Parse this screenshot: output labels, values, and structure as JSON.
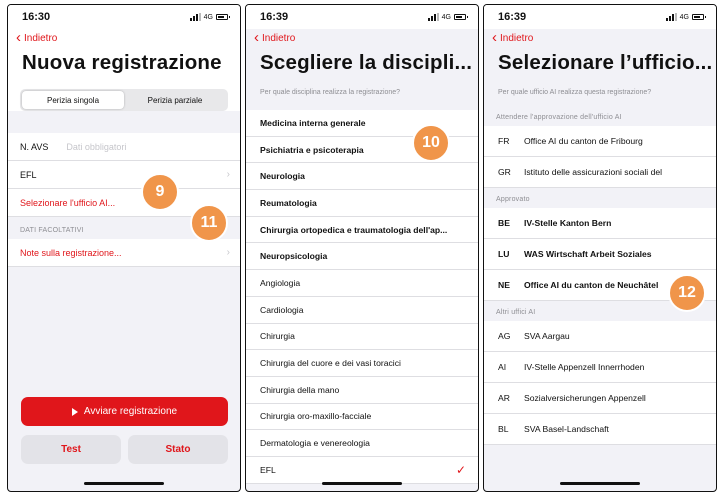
{
  "screen1": {
    "time": "16:30",
    "network": "4G",
    "back": "Indietro",
    "title": "Nuova registrazione",
    "segments": [
      "Perizia singola",
      "Perizia parziale"
    ],
    "avs_label": "N. AVS",
    "avs_placeholder": "Dati obbligatori",
    "efl": "EFL",
    "office": "Selezionare l'ufficio AI...",
    "optional_header": "DATI FACOLTATIVI",
    "notes": "Note sulla registrazione...",
    "start": "Avviare registrazione",
    "test": "Test",
    "status": "Stato"
  },
  "screen2": {
    "time": "16:39",
    "network": "4G",
    "back": "Indietro",
    "title": "Scegliere la discipli...",
    "question": "Per quale disciplina realizza la registrazione?",
    "items": [
      {
        "label": "Medicina interna generale",
        "bold": true
      },
      {
        "label": "Psichiatria e psicoterapia",
        "bold": true
      },
      {
        "label": "Neurologia",
        "bold": true
      },
      {
        "label": "Reumatologia",
        "bold": true
      },
      {
        "label": "Chirurgia ortopedica e traumatologia dell'ap...",
        "bold": true
      },
      {
        "label": "Neuropsicologia",
        "bold": true
      },
      {
        "label": "Angiologia",
        "bold": false
      },
      {
        "label": "Cardiologia",
        "bold": false
      },
      {
        "label": "Chirurgia",
        "bold": false
      },
      {
        "label": "Chirurgia del cuore e dei vasi toracici",
        "bold": false
      },
      {
        "label": "Chirurgia della mano",
        "bold": false
      },
      {
        "label": "Chirurgia oro-maxillo-facciale",
        "bold": false
      },
      {
        "label": "Dermatologia e venereologia",
        "bold": false
      },
      {
        "label": "EFL",
        "bold": false
      }
    ]
  },
  "screen3": {
    "time": "16:39",
    "network": "4G",
    "back": "Indietro",
    "title": "Selezionare l’ufficio...",
    "question": "Per quale ufficio AI realizza questa registrazione?",
    "section_pending": "Attendere l'approvazione dell'ufficio AI",
    "pending": [
      {
        "code": "FR",
        "name": "Office AI du canton de Fribourg"
      },
      {
        "code": "GR",
        "name": "Istituto delle assicurazioni sociali del"
      }
    ],
    "section_approved": "Approvato",
    "approved": [
      {
        "code": "BE",
        "name": "IV-Stelle Kanton Bern"
      },
      {
        "code": "LU",
        "name": "WAS Wirtschaft Arbeit Soziales"
      },
      {
        "code": "NE",
        "name": "Office AI du canton de Neuchâtel"
      }
    ],
    "section_other": "Altri uffici AI",
    "other": [
      {
        "code": "AG",
        "name": "SVA Aargau"
      },
      {
        "code": "AI",
        "name": "IV-Stelle Appenzell Innerrhoden"
      },
      {
        "code": "AR",
        "name": "Sozialversicherungen Appenzell"
      },
      {
        "code": "BL",
        "name": "SVA Basel-Landschaft"
      }
    ]
  },
  "markers": [
    "9",
    "10",
    "11",
    "12"
  ],
  "colors": {
    "accent": "#e0161b",
    "marker": "#f0954a"
  }
}
